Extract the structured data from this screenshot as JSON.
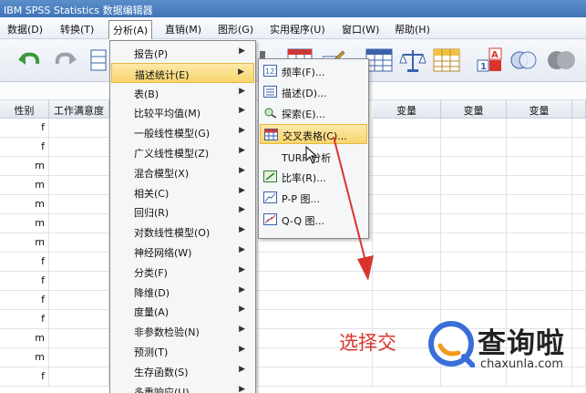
{
  "window": {
    "title": "IBM SPSS Statistics 数据编辑器"
  },
  "menubar": [
    {
      "label": "数据(D)",
      "active": false
    },
    {
      "label": "转换(T)",
      "active": false
    },
    {
      "label": "分析(A)",
      "active": true
    },
    {
      "label": "直销(M)",
      "active": false
    },
    {
      "label": "图形(G)",
      "active": false
    },
    {
      "label": "实用程序(U)",
      "active": false
    },
    {
      "label": "窗口(W)",
      "active": false
    },
    {
      "label": "帮助(H)",
      "active": false
    }
  ],
  "toolbar": {
    "icons": [
      "undo-icon",
      "redo-icon",
      "goto-case-icon",
      "insert-cases-icon",
      "split-file-icon",
      "weight-cases-icon",
      "select-cases-icon",
      "value-labels-icon",
      "use-sets-icon",
      "show-all-icon"
    ]
  },
  "grid": {
    "columns": [
      "性别",
      "工作满意度",
      "变量",
      "变量",
      "变量"
    ],
    "rows": [
      "f",
      "f",
      "m",
      "m",
      "m",
      "m",
      "m",
      "f",
      "f",
      "f",
      "f",
      "m",
      "m",
      "f"
    ]
  },
  "analyze_menu": {
    "items": [
      {
        "label": "报告(P)",
        "has_submenu": true,
        "highlighted": false
      },
      {
        "label": "描述统计(E)",
        "has_submenu": true,
        "highlighted": true
      },
      {
        "label": "表(B)",
        "has_submenu": true,
        "highlighted": false
      },
      {
        "label": "比较平均值(M)",
        "has_submenu": true,
        "highlighted": false
      },
      {
        "label": "一般线性模型(G)",
        "has_submenu": true,
        "highlighted": false
      },
      {
        "label": "广义线性模型(Z)",
        "has_submenu": true,
        "highlighted": false
      },
      {
        "label": "混合模型(X)",
        "has_submenu": true,
        "highlighted": false
      },
      {
        "label": "相关(C)",
        "has_submenu": true,
        "highlighted": false
      },
      {
        "label": "回归(R)",
        "has_submenu": true,
        "highlighted": false
      },
      {
        "label": "对数线性模型(O)",
        "has_submenu": true,
        "highlighted": false
      },
      {
        "label": "神经网络(W)",
        "has_submenu": true,
        "highlighted": false
      },
      {
        "label": "分类(F)",
        "has_submenu": true,
        "highlighted": false
      },
      {
        "label": "降维(D)",
        "has_submenu": true,
        "highlighted": false
      },
      {
        "label": "度量(A)",
        "has_submenu": true,
        "highlighted": false
      },
      {
        "label": "非参数检验(N)",
        "has_submenu": true,
        "highlighted": false
      },
      {
        "label": "预测(T)",
        "has_submenu": true,
        "highlighted": false
      },
      {
        "label": "生存函数(S)",
        "has_submenu": true,
        "highlighted": false
      },
      {
        "label": "多重响应(U)",
        "has_submenu": true,
        "highlighted": false
      }
    ]
  },
  "descriptive_submenu": {
    "items": [
      {
        "label": "频率(F)...",
        "icon": "frequencies-icon",
        "highlighted": false
      },
      {
        "label": "描述(D)...",
        "icon": "descriptives-icon",
        "highlighted": false
      },
      {
        "label": "探索(E)...",
        "icon": "explore-icon",
        "highlighted": false
      },
      {
        "label": "交叉表格(C)...",
        "icon": "crosstabs-icon",
        "highlighted": true
      },
      {
        "label": "TURF 分析",
        "icon": "",
        "highlighted": false
      },
      {
        "label": "比率(R)...",
        "icon": "ratio-icon",
        "highlighted": false
      },
      {
        "label": "P-P 图...",
        "icon": "pp-plot-icon",
        "highlighted": false
      },
      {
        "label": "Q-Q 图...",
        "icon": "qq-plot-icon",
        "highlighted": false
      }
    ]
  },
  "annotation": {
    "text": "选择交"
  },
  "watermark": {
    "name": "查询啦",
    "url": "chaxunla.com"
  },
  "colors": {
    "accent": "#3f74b8",
    "highlight": "#f8d56c",
    "annotation": "#d9342b",
    "logo_blue": "#3a6fd8",
    "logo_orange": "#f39a1e"
  }
}
